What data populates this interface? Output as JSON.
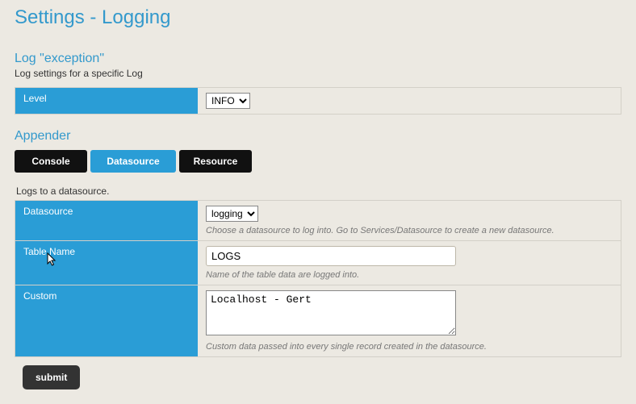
{
  "page_title": "Settings - Logging",
  "log": {
    "section_title": "Log \"exception\"",
    "section_desc": "Log settings for a specific Log",
    "level": {
      "label": "Level",
      "value": "INFO",
      "options": [
        "INFO"
      ]
    }
  },
  "appender": {
    "title": "Appender",
    "tabs": {
      "console": "Console",
      "datasource": "Datasource",
      "resource": "Resource"
    },
    "desc": "Logs to a datasource.",
    "fields": {
      "datasource": {
        "label": "Datasource",
        "value": "logging",
        "options": [
          "logging"
        ],
        "hint": "Choose a datasource to log into. Go to Services/Datasource to create a new datasource."
      },
      "table_name": {
        "label": "Table Name",
        "value": "LOGS",
        "hint": "Name of the table data are logged into."
      },
      "custom": {
        "label": "Custom",
        "value": "Localhost - Gert",
        "hint": "Custom data passed into every single record created in the datasource."
      }
    }
  },
  "submit_label": "submit"
}
